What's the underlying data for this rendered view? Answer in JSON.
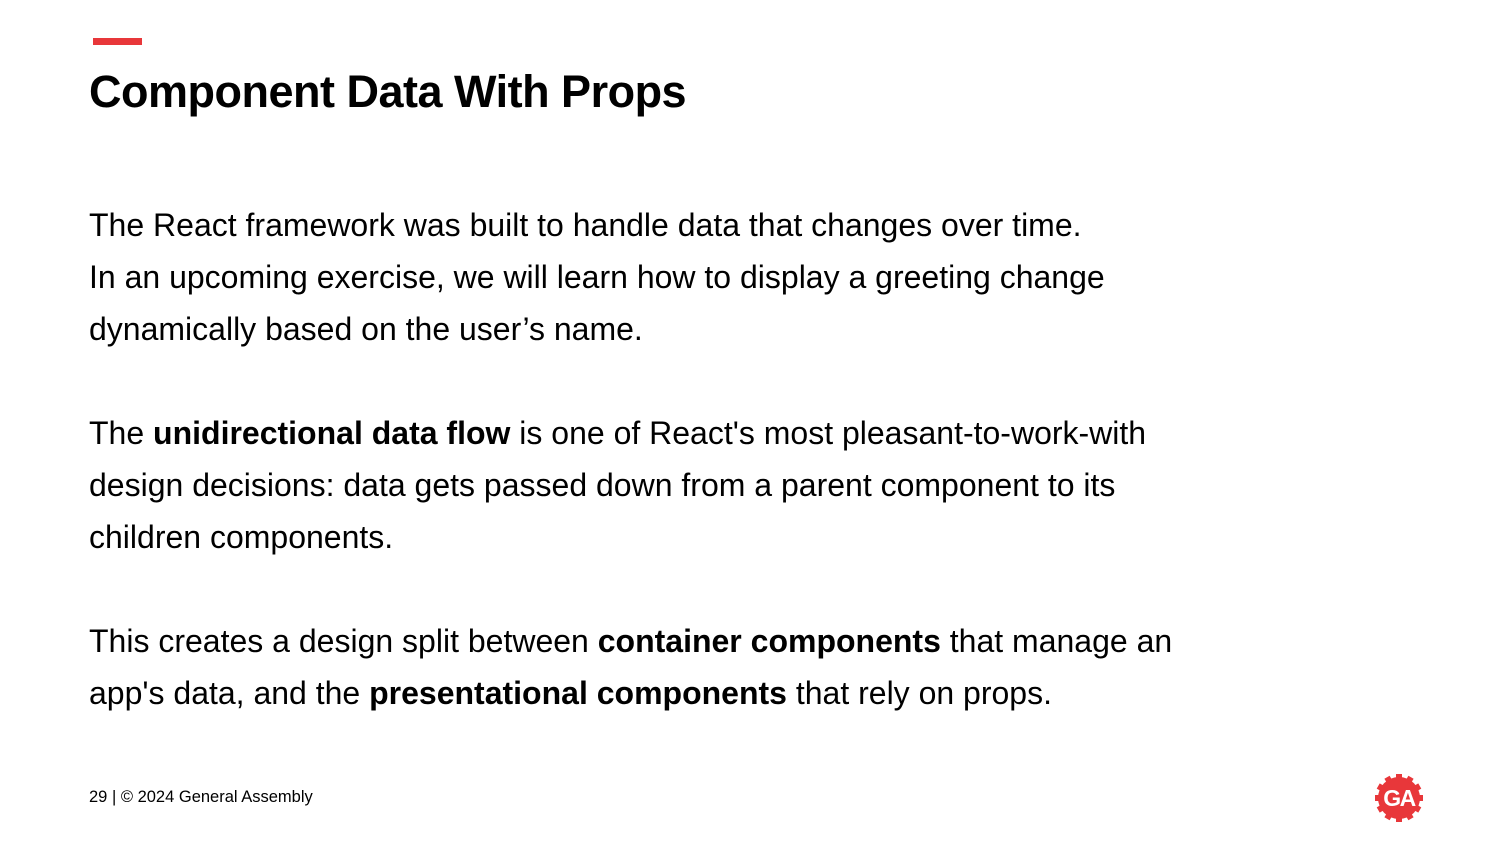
{
  "title": "Component Data With Props",
  "paragraphs": {
    "p1": {
      "line1": "The React framework was built to handle data that changes over time.",
      "line2": "In an upcoming exercise, we will learn how to display a greeting change",
      "line3": "dynamically based on the user’s name."
    },
    "p2": {
      "line1_pre": "The ",
      "line1_bold": "unidirectional data flow",
      "line1_post": " is one of React's most pleasant-to-work-with",
      "line2": "design decisions: data gets passed down from a parent component to its",
      "line3": "children components."
    },
    "p3": {
      "line1_pre": "This creates a design split between ",
      "line1_bold": "container components",
      "line1_post": " that manage an",
      "line2_pre": "app's data, and the ",
      "line2_bold": "presentational components",
      "line2_post": " that rely on props."
    }
  },
  "footer": {
    "page_number": "29",
    "separator": " | ",
    "copyright": "© 2024 General Assembly"
  },
  "logo": {
    "text": "GA",
    "color": "#e8373a",
    "icon": "general-assembly-logo-icon"
  },
  "colors": {
    "accent": "#e8373a",
    "text": "#000000",
    "background": "#ffffff"
  }
}
